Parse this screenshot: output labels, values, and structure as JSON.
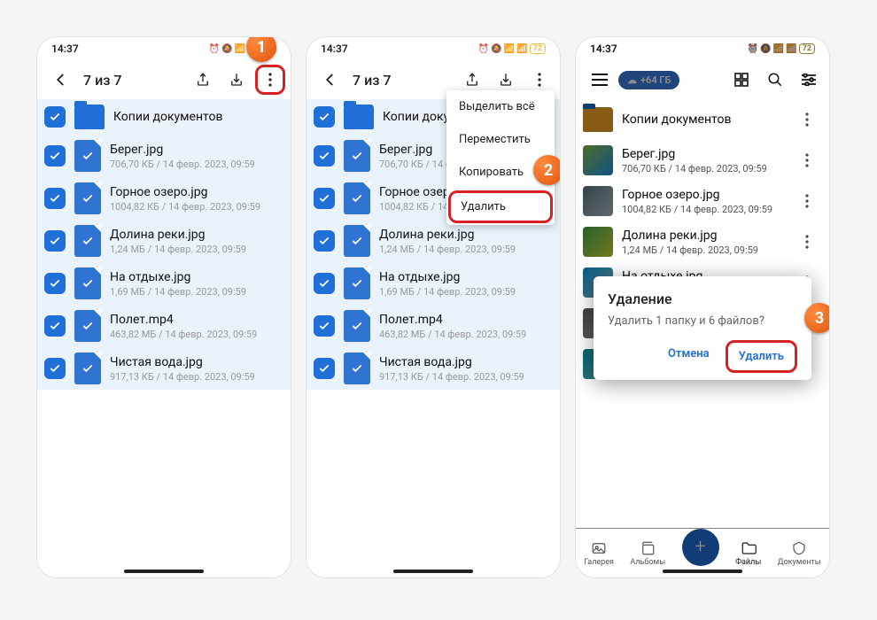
{
  "status": {
    "time": "14:37",
    "battery": "72"
  },
  "selection_title": "7 из 7",
  "files": [
    {
      "name": "Копии документов",
      "meta": "",
      "type": "folder"
    },
    {
      "name": "Берег.jpg",
      "meta": "706,70 КБ / 14 февр. 2023, 09:59",
      "type": "file"
    },
    {
      "name": "Горное озеро.jpg",
      "meta": "1004,82 КБ / 14 февр. 2023, 09:59",
      "type": "file"
    },
    {
      "name": "Долина реки.jpg",
      "meta": "1,24 МБ / 14 февр. 2023, 09:59",
      "type": "file"
    },
    {
      "name": "На отдыхе.jpg",
      "meta": "1,69 МБ / 14 февр. 2023, 09:59",
      "type": "file"
    },
    {
      "name": "Полет.mp4",
      "meta": "463,82 МБ / 14 февр. 2023, 09:59",
      "type": "file"
    },
    {
      "name": "Чистая вода.jpg",
      "meta": "917,13 КБ / 14 февр. 2023, 09:59",
      "type": "file"
    }
  ],
  "menu": {
    "select_all": "Выделить всё",
    "move": "Переместить",
    "copy": "Копировать",
    "delete": "Удалить"
  },
  "dialog": {
    "title": "Удаление",
    "text": "Удалить 1 папку и 6 файлов?",
    "cancel": "Отмена",
    "confirm": "Удалить"
  },
  "upsell": "+64 ГБ",
  "nav": {
    "gallery": "Галерея",
    "albums": "Альбомы",
    "files": "Файлы",
    "docs": "Документы"
  },
  "badges": {
    "b1": "1",
    "b2": "2",
    "b3": "3"
  }
}
